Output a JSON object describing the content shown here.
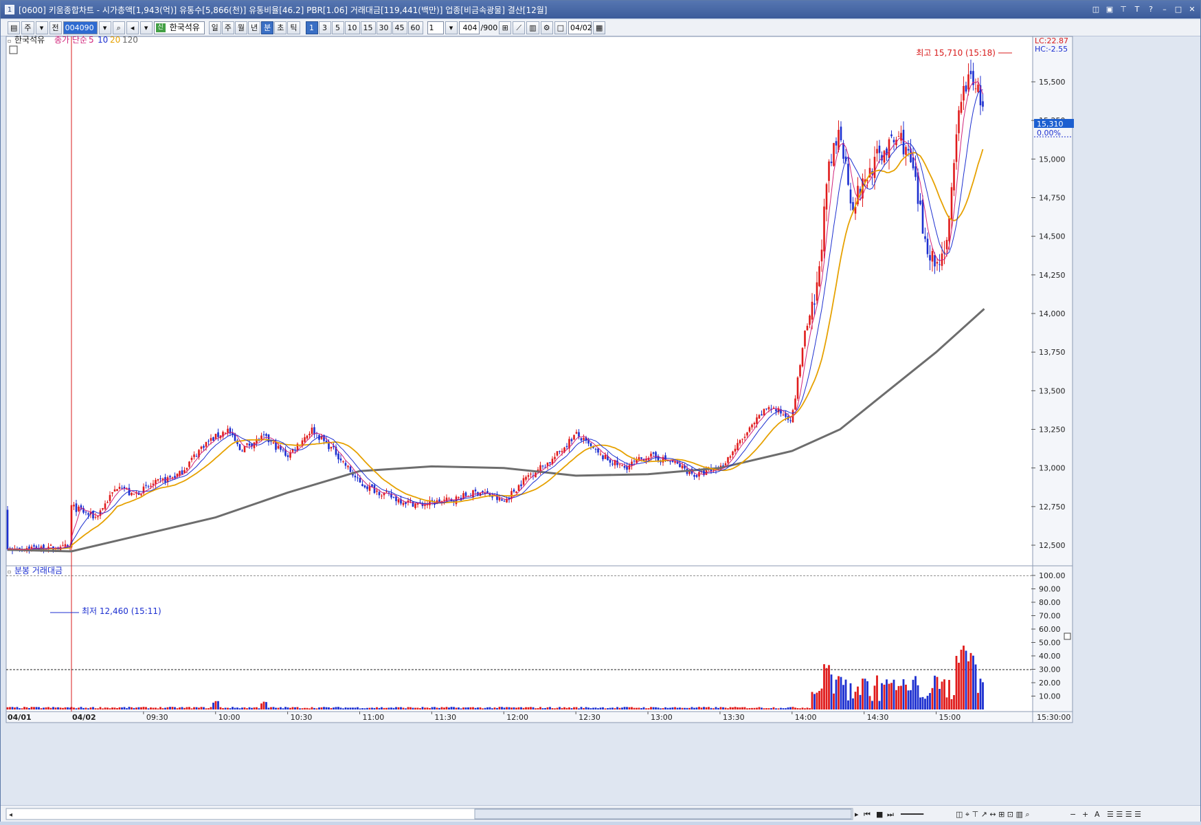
{
  "window": {
    "number": "1",
    "title": "[0600] 키움종합차트 - 시가총액[1,943(억)] 유통수[5,866(천)] 유통비율[46.2] PBR[1.06] 거래대금[119,441(백만)] 업종[비금속광물] 결산[12월]"
  },
  "toolbar": {
    "market": "주",
    "prev": "전",
    "code": "004090",
    "stock": "한국석유",
    "stock_tag": "신",
    "periods": [
      "일",
      "주",
      "월",
      "년",
      "분",
      "초",
      "틱"
    ],
    "active_period": "분",
    "intervals": [
      "1",
      "3",
      "5",
      "10",
      "15",
      "30",
      "45",
      "60"
    ],
    "active_interval": "1",
    "count": "1",
    "range": "404",
    "range_total": "/900",
    "date": "04/02"
  },
  "legend": {
    "stock": "한국석유",
    "ma_label": "종가 단순",
    "ma5": "5",
    "ma10": "10",
    "ma20": "20",
    "ma120": "120",
    "volume_panel": "분봉 거래대금"
  },
  "annotations": {
    "high": "최고 15,710 (15:18)",
    "low": "최저 12,460 (15:11)",
    "lc": "LC:22.87",
    "hc": "HC:-2.55",
    "current_price": "15,310",
    "current_change": "0.00%"
  },
  "colors": {
    "up": "#e01b1b",
    "down": "#1c2fd0",
    "ma5": "#d1237a",
    "ma10": "#1c2fd0",
    "ma20": "#e6a100",
    "ma120": "#6d6d6d",
    "date_line": "#d81b1b",
    "price_tag": "#1c5fd0"
  },
  "chart_data": [
    {
      "type": "candlestick",
      "title": "",
      "y_axis_ticks": [
        "15,500",
        "15,250",
        "15,000",
        "14,750",
        "14,500",
        "14,250",
        "14,000",
        "13,750",
        "13,500",
        "13,250",
        "13,000",
        "12,750",
        "12,500"
      ],
      "ylim": [
        12350,
        15800
      ],
      "x_axis_ticks": [
        "04/01",
        "04/02",
        "09:30",
        "10:00",
        "10:30",
        "11:00",
        "11:30",
        "12:00",
        "12:30",
        "13:00",
        "13:30",
        "14:00",
        "14:30",
        "15:00",
        "15:30:00"
      ],
      "close_path": [
        {
          "t": "09:00",
          "close": 12750
        },
        {
          "t": "09:10",
          "close": 12680
        },
        {
          "t": "09:20",
          "close": 12900
        },
        {
          "t": "09:25",
          "close": 12820
        },
        {
          "t": "09:35",
          "close": 12900
        },
        {
          "t": "09:45",
          "close": 12960
        },
        {
          "t": "09:55",
          "close": 13150
        },
        {
          "t": "10:05",
          "close": 13250
        },
        {
          "t": "10:10",
          "close": 13120
        },
        {
          "t": "10:20",
          "close": 13200
        },
        {
          "t": "10:30",
          "close": 13080
        },
        {
          "t": "10:40",
          "close": 13250
        },
        {
          "t": "10:50",
          "close": 13100
        },
        {
          "t": "11:00",
          "close": 12900
        },
        {
          "t": "11:15",
          "close": 12800
        },
        {
          "t": "11:25",
          "close": 12760
        },
        {
          "t": "11:40",
          "close": 12800
        },
        {
          "t": "11:50",
          "close": 12850
        },
        {
          "t": "12:00",
          "close": 12780
        },
        {
          "t": "12:10",
          "close": 12950
        },
        {
          "t": "12:20",
          "close": 13050
        },
        {
          "t": "12:30",
          "close": 13220
        },
        {
          "t": "12:40",
          "close": 13080
        },
        {
          "t": "12:50",
          "close": 13000
        },
        {
          "t": "13:00",
          "close": 13080
        },
        {
          "t": "13:10",
          "close": 13040
        },
        {
          "t": "13:20",
          "close": 12950
        },
        {
          "t": "13:30",
          "close": 13000
        },
        {
          "t": "13:40",
          "close": 13200
        },
        {
          "t": "13:50",
          "close": 13400
        },
        {
          "t": "14:00",
          "close": 13320
        },
        {
          "t": "14:05",
          "close": 13850
        },
        {
          "t": "14:10",
          "close": 14100
        },
        {
          "t": "14:15",
          "close": 14900
        },
        {
          "t": "14:20",
          "close": 15200
        },
        {
          "t": "14:25",
          "close": 14700
        },
        {
          "t": "14:35",
          "close": 15000
        },
        {
          "t": "14:45",
          "close": 15150
        },
        {
          "t": "14:50",
          "close": 14950
        },
        {
          "t": "14:55",
          "close": 14500
        },
        {
          "t": "15:00",
          "close": 14300
        },
        {
          "t": "15:05",
          "close": 14500
        },
        {
          "t": "15:10",
          "close": 15400
        },
        {
          "t": "15:15",
          "close": 15550
        },
        {
          "t": "15:20",
          "close": 15310
        }
      ],
      "ma120_path": [
        {
          "t": "09:00",
          "v": 12460
        },
        {
          "t": "09:30",
          "v": 12570
        },
        {
          "t": "10:00",
          "v": 12680
        },
        {
          "t": "10:30",
          "v": 12840
        },
        {
          "t": "11:00",
          "v": 12980
        },
        {
          "t": "11:30",
          "v": 13010
        },
        {
          "t": "12:00",
          "v": 13000
        },
        {
          "t": "12:30",
          "v": 12950
        },
        {
          "t": "13:00",
          "v": 12960
        },
        {
          "t": "13:30",
          "v": 13000
        },
        {
          "t": "14:00",
          "v": 13110
        },
        {
          "t": "14:20",
          "v": 13250
        },
        {
          "t": "14:40",
          "v": 13500
        },
        {
          "t": "15:00",
          "v": 13750
        },
        {
          "t": "15:20",
          "v": 14030
        }
      ]
    },
    {
      "type": "bar",
      "title": "",
      "y_axis_ticks": [
        "100.00",
        "90.00",
        "80.00",
        "70.00",
        "60.00",
        "50.00",
        "40.00",
        "30.00",
        "20.00",
        "10.00"
      ],
      "ylim": [
        0,
        100
      ],
      "reference_lines": [
        100,
        30
      ],
      "spikes": [
        {
          "t": "10:00",
          "v": 7
        },
        {
          "t": "10:20",
          "v": 6
        },
        {
          "t": "14:10",
          "v": 15
        },
        {
          "t": "14:15",
          "v": 35
        },
        {
          "t": "14:20",
          "v": 25
        },
        {
          "t": "14:40",
          "v": 20
        },
        {
          "t": "15:10",
          "v": 49
        },
        {
          "t": "15:15",
          "v": 35
        },
        {
          "t": "15:20",
          "v": 29
        }
      ]
    }
  ]
}
